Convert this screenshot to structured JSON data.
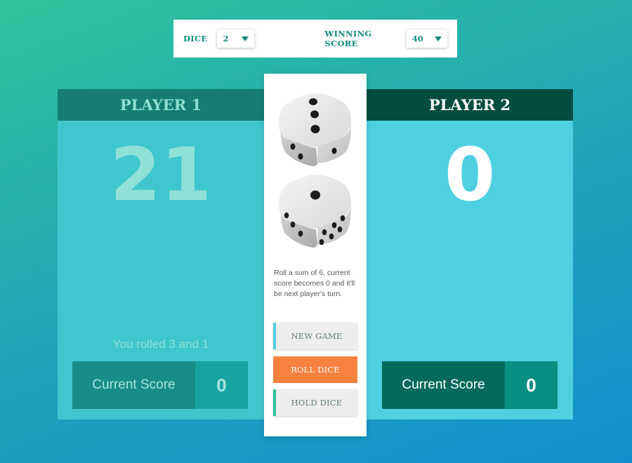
{
  "settings": {
    "dice_label": "DICE",
    "dice_value": "2",
    "winning_label": "WINNING SCORE",
    "winning_value": "40"
  },
  "player1": {
    "name": "PLAYER 1",
    "score": "21",
    "roll_message": "You rolled 3 and 1",
    "current_label": "Current Score",
    "current_value": "0"
  },
  "player2": {
    "name": "PLAYER 2",
    "score": "0",
    "roll_message": "",
    "current_label": "Current Score",
    "current_value": "0"
  },
  "center": {
    "dice": [
      {
        "icon": "die-face-3-icon",
        "top_face": 3
      },
      {
        "icon": "die-face-1-icon",
        "top_face": 1
      }
    ],
    "rule_text": "Roll a sum of 6, current score becomes 0 and it'll be next player's turn.",
    "new_game": "NEW GAME",
    "roll_dice": "ROLL DICE",
    "hold_dice": "HOLD DICE"
  },
  "colors": {
    "accent_orange": "#f7813e",
    "active_header": "#034d40",
    "inactive_header": "#157d73",
    "teal_text": "#128c7e"
  }
}
